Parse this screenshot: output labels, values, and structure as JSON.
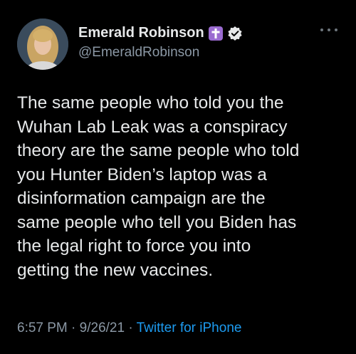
{
  "author": {
    "display_name": "Emerald Robinson",
    "handle": "@EmeraldRobinson"
  },
  "icons": {
    "badge": "latin-cross-icon",
    "verified": "verified-badge-icon",
    "more": "more-horizontal-icon"
  },
  "colors": {
    "background": "#000000",
    "text": "#e7e9ea",
    "secondary": "#8b98a5",
    "link": "#1d9bf0",
    "cross_badge": "#9a6bd0"
  },
  "tweet": {
    "lines": [
      "The same people who told you the",
      "Wuhan Lab Leak was a conspiracy",
      "theory are the same people who told",
      "you Hunter Biden’s laptop was a",
      "disinformation campaign are the",
      "same people who tell you Biden has",
      "the legal right to force you into",
      "getting the new vaccines."
    ]
  },
  "meta": {
    "time": "6:57 PM",
    "separator": " · ",
    "date": "9/26/21",
    "source": "Twitter for iPhone"
  }
}
